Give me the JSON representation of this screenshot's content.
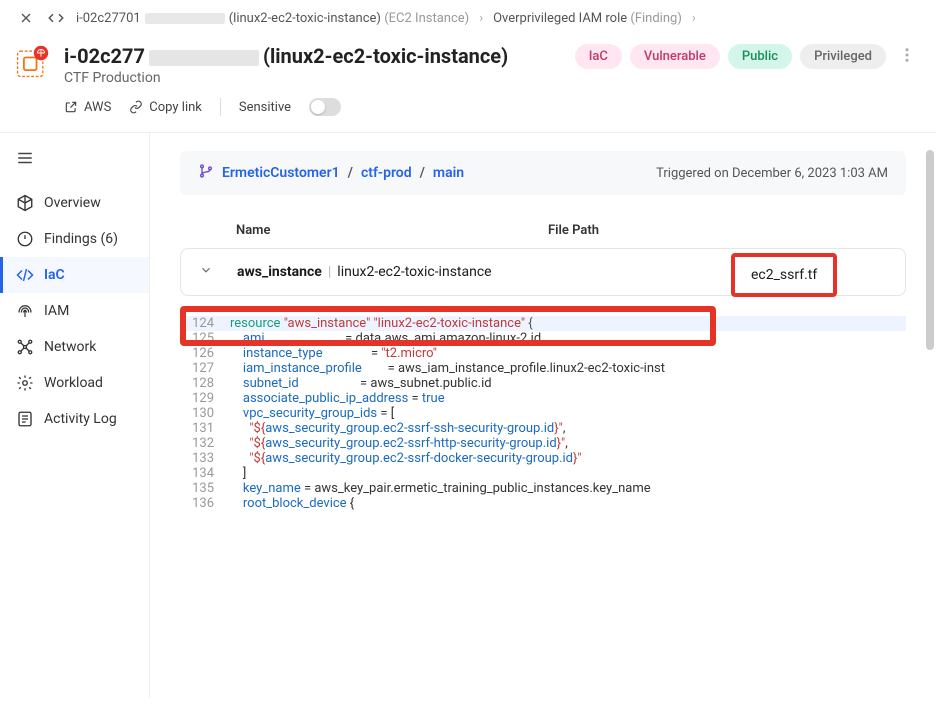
{
  "breadcrumb": {
    "instance_id": "i-02c27701",
    "instance_name": "(linux2-ec2-toxic-instance)",
    "instance_type": "(EC2 Instance)",
    "finding_label": "Overprivileged IAM role",
    "finding_type": "(Finding)"
  },
  "header": {
    "title": "i-02c277              (linux2-ec2-toxic-instance)",
    "subtitle": "CTF Production",
    "tags": {
      "iac": "IaC",
      "vulnerable": "Vulnerable",
      "public": "Public",
      "privileged": "Privileged"
    }
  },
  "actions": {
    "aws": "AWS",
    "copy": "Copy link",
    "sensitive": "Sensitive"
  },
  "sidebar": {
    "overview": "Overview",
    "findings": "Findings (6)",
    "iac": "IaC",
    "iam": "IAM",
    "network": "Network",
    "workload": "Workload",
    "activity": "Activity Log"
  },
  "repo": {
    "org": "ErmeticCustomer1",
    "project": "ctf-prod",
    "branch": "main",
    "triggered": "Triggered on December 6, 2023 1:03 AM"
  },
  "table": {
    "name_header": "Name",
    "path_header": "File Path",
    "row": {
      "resource_type": "aws_instance",
      "resource_name": "linux2-ec2-toxic-instance",
      "file_path": "ec2_ssrf.tf"
    }
  },
  "code": {
    "lines": [
      {
        "n": "124",
        "hl": true,
        "parts": [
          [
            "kw-resource",
            "resource"
          ],
          [
            "",
            " "
          ],
          [
            "kw-str",
            "\"aws_instance\""
          ],
          [
            "",
            " "
          ],
          [
            "kw-str",
            "\"linux2-ec2-toxic-instance\""
          ],
          [
            "",
            " "
          ],
          [
            "kw-punct",
            "{"
          ]
        ]
      },
      {
        "n": "125",
        "parts": [
          [
            "",
            "    "
          ],
          [
            "kw-attr",
            "ami"
          ],
          [
            "",
            "                         = "
          ],
          [
            "kw-access",
            "data.aws_ami.amazon-linux-2.id"
          ]
        ]
      },
      {
        "n": "126",
        "parts": [
          [
            "",
            "    "
          ],
          [
            "kw-attr",
            "instance_type"
          ],
          [
            "",
            "               = "
          ],
          [
            "kw-str",
            "\"t2.micro\""
          ]
        ]
      },
      {
        "n": "127",
        "parts": [
          [
            "",
            "    "
          ],
          [
            "kw-attr",
            "iam_instance_profile"
          ],
          [
            "",
            "        = "
          ],
          [
            "kw-access",
            "aws_iam_instance_profile.linux2-ec2-toxic-inst"
          ]
        ]
      },
      {
        "n": "128",
        "parts": [
          [
            "",
            "    "
          ],
          [
            "kw-attr",
            "subnet_id"
          ],
          [
            "",
            "                   = "
          ],
          [
            "kw-access",
            "aws_subnet.public.id"
          ]
        ]
      },
      {
        "n": "129",
        "parts": [
          [
            "",
            "    "
          ],
          [
            "kw-attr",
            "associate_public_ip_address"
          ],
          [
            "",
            " = "
          ],
          [
            "kw-bool",
            "true"
          ]
        ]
      },
      {
        "n": "130",
        "parts": [
          [
            "",
            "    "
          ],
          [
            "kw-attr",
            "vpc_security_group_ids"
          ],
          [
            "",
            " = ["
          ]
        ]
      },
      {
        "n": "131",
        "parts": [
          [
            "",
            "      "
          ],
          [
            "kw-str",
            "\"${"
          ],
          [
            "kw-interp",
            "aws_security_group.ec2-ssrf-ssh-security-group.id"
          ],
          [
            "kw-str",
            "}\""
          ],
          [
            "",
            ","
          ]
        ]
      },
      {
        "n": "132",
        "parts": [
          [
            "",
            "      "
          ],
          [
            "kw-str",
            "\"${"
          ],
          [
            "kw-interp",
            "aws_security_group.ec2-ssrf-http-security-group.id"
          ],
          [
            "kw-str",
            "}\""
          ],
          [
            "",
            ","
          ]
        ]
      },
      {
        "n": "133",
        "parts": [
          [
            "",
            "      "
          ],
          [
            "kw-str",
            "\"${"
          ],
          [
            "kw-interp",
            "aws_security_group.ec2-ssrf-docker-security-group.id"
          ],
          [
            "kw-str",
            "}\""
          ]
        ]
      },
      {
        "n": "134",
        "parts": [
          [
            "",
            "    ]"
          ]
        ]
      },
      {
        "n": "135",
        "parts": [
          [
            "",
            "    "
          ],
          [
            "kw-attr",
            "key_name"
          ],
          [
            "",
            " = "
          ],
          [
            "kw-access",
            "aws_key_pair.ermetic_training_public_instances.key_name"
          ]
        ]
      },
      {
        "n": "136",
        "parts": [
          [
            "",
            "    "
          ],
          [
            "kw-attr",
            "root_block_device"
          ],
          [
            "",
            " {"
          ]
        ]
      }
    ]
  }
}
